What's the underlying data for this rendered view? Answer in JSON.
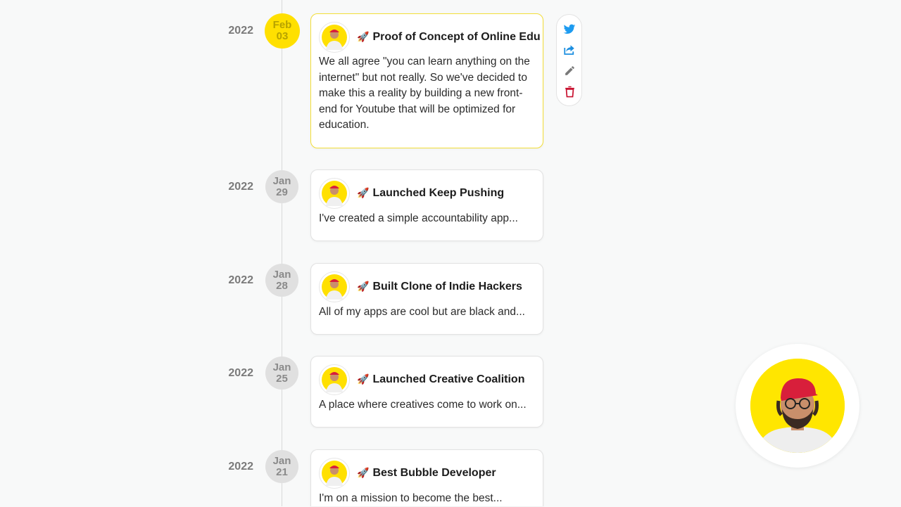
{
  "colors": {
    "accent": "#ffe000",
    "twitter": "#1d9bf0",
    "share": "#1d8fe0",
    "edit": "#7a7a7a",
    "delete": "#c8102e"
  },
  "icons": {
    "tweet": "twitter-icon",
    "share": "share-icon",
    "edit": "pencil-icon",
    "delete": "trash-icon",
    "rocket": "rocket-icon"
  },
  "entries": [
    {
      "year": "2022",
      "month": "Feb",
      "day": "03",
      "emoji": "🚀",
      "title": "Proof of Concept of Online Edu",
      "description": "We all agree \"you can learn anything on the internet\" but not really. So we've decided to make this a reality by building a new front-end for Youtube that will be optimized for education.",
      "selected": true
    },
    {
      "year": "2022",
      "month": "Jan",
      "day": "29",
      "emoji": "🚀",
      "title": "Launched Keep Pushing",
      "description": "I've created a simple accountability app...",
      "selected": false
    },
    {
      "year": "2022",
      "month": "Jan",
      "day": "28",
      "emoji": "🚀",
      "title": "Built Clone of Indie Hackers",
      "description": "All of my apps are cool but are black and...",
      "selected": false
    },
    {
      "year": "2022",
      "month": "Jan",
      "day": "25",
      "emoji": "🚀",
      "title": "Launched Creative Coalition",
      "description": "A place where creatives come to work on...",
      "selected": false
    },
    {
      "year": "2022",
      "month": "Jan",
      "day": "21",
      "emoji": "🚀",
      "title": "Best Bubble Developer",
      "description": "I'm on a mission to become the best...",
      "selected": false
    }
  ]
}
